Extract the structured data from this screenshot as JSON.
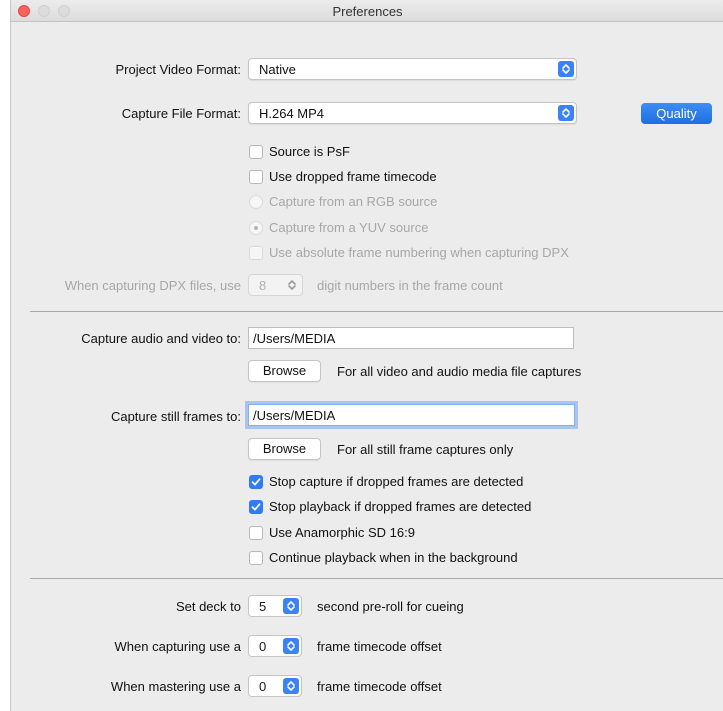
{
  "window": {
    "title": "Preferences"
  },
  "format": {
    "project_video_label": "Project Video Format:",
    "project_video_value": "Native",
    "capture_file_label": "Capture File Format:",
    "capture_file_value": "H.264 MP4",
    "quality_button": "Quality"
  },
  "options": {
    "source_psf": {
      "label": "Source is PsF",
      "checked": false
    },
    "dropped_timecode": {
      "label": "Use dropped frame timecode",
      "checked": false
    },
    "rgb_source": {
      "label": "Capture from an RGB source",
      "selected": false,
      "disabled": true
    },
    "yuv_source": {
      "label": "Capture from a YUV source",
      "selected": true,
      "disabled": true
    },
    "absolute_numbering": {
      "label": "Use absolute frame numbering when capturing DPX",
      "checked": false,
      "disabled": true
    }
  },
  "dpx": {
    "label": "When capturing DPX files, use",
    "value": "8",
    "suffix": "digit numbers in the frame count"
  },
  "capture_av": {
    "label": "Capture audio and video to:",
    "path": "/Users/MEDIA",
    "browse": "Browse",
    "hint": "For all video and audio media file captures"
  },
  "capture_still": {
    "label": "Capture still frames to:",
    "path": "/Users/MEDIA",
    "browse": "Browse",
    "hint": "For all still frame captures only"
  },
  "checks": [
    {
      "label": "Stop capture if dropped frames are detected",
      "checked": true
    },
    {
      "label": "Stop playback if dropped frames are detected",
      "checked": true
    },
    {
      "label": "Use Anamorphic SD 16:9",
      "checked": false
    },
    {
      "label": "Continue playback when in the background",
      "checked": false
    }
  ],
  "deck": {
    "preroll_label": "Set deck to",
    "preroll_value": "5",
    "preroll_suffix": "second pre-roll for cueing",
    "capture_label": "When capturing use a",
    "capture_value": "0",
    "capture_suffix": "frame timecode offset",
    "master_label": "When mastering use a",
    "master_value": "0",
    "master_suffix": "frame timecode offset"
  },
  "colors": {
    "accent": "#2f7cf6",
    "close": "#fc605c"
  }
}
